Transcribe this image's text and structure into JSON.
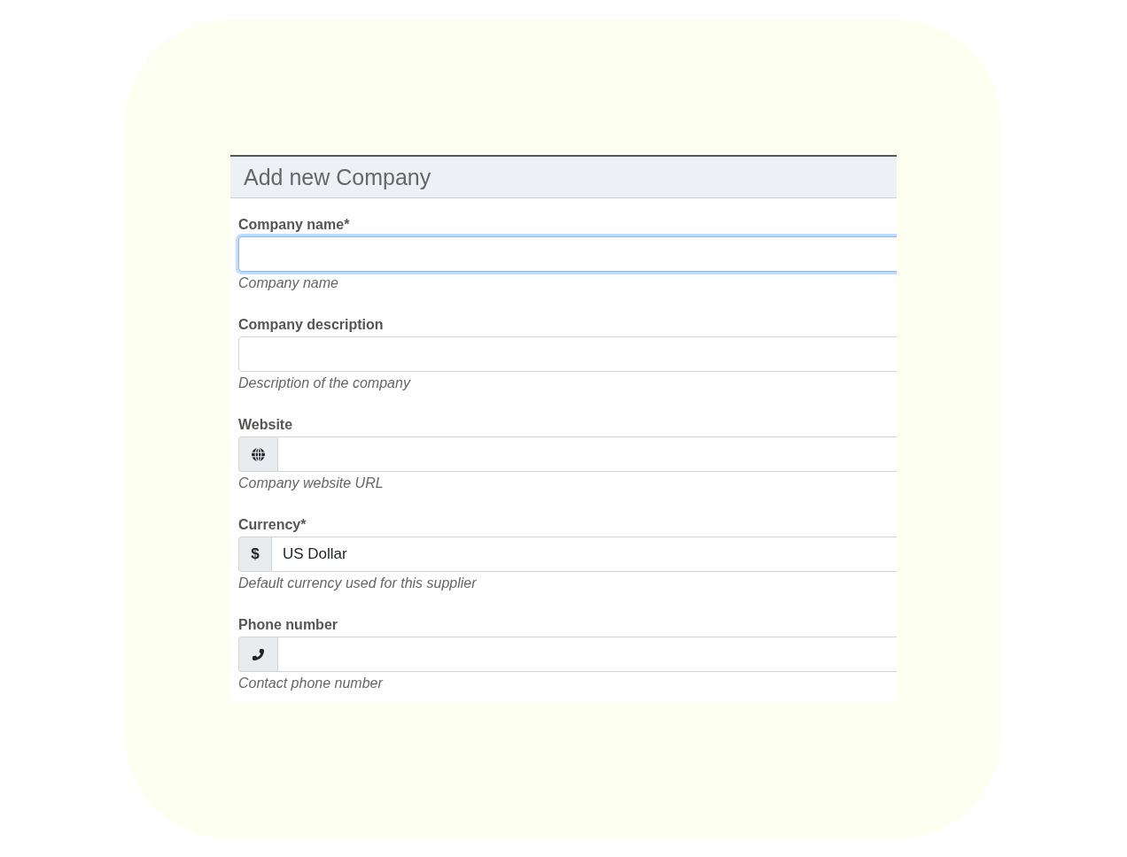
{
  "dialog": {
    "title": "Add new Company",
    "fields": [
      {
        "kind": "text",
        "label": "Company name*",
        "focused": true,
        "help": "Company name"
      },
      {
        "kind": "text",
        "label": "Company description",
        "focused": false,
        "help": "Description of the company"
      },
      {
        "kind": "url",
        "label": "Website",
        "focused": false,
        "help": "Company website URL"
      },
      {
        "kind": "currency",
        "label": "Currency*",
        "addon": "$",
        "value": "US Dollar",
        "focused": false,
        "help": "Default currency used for this supplier"
      },
      {
        "kind": "phone",
        "label": "Phone number",
        "focused": false,
        "help": "Contact phone number"
      }
    ]
  }
}
